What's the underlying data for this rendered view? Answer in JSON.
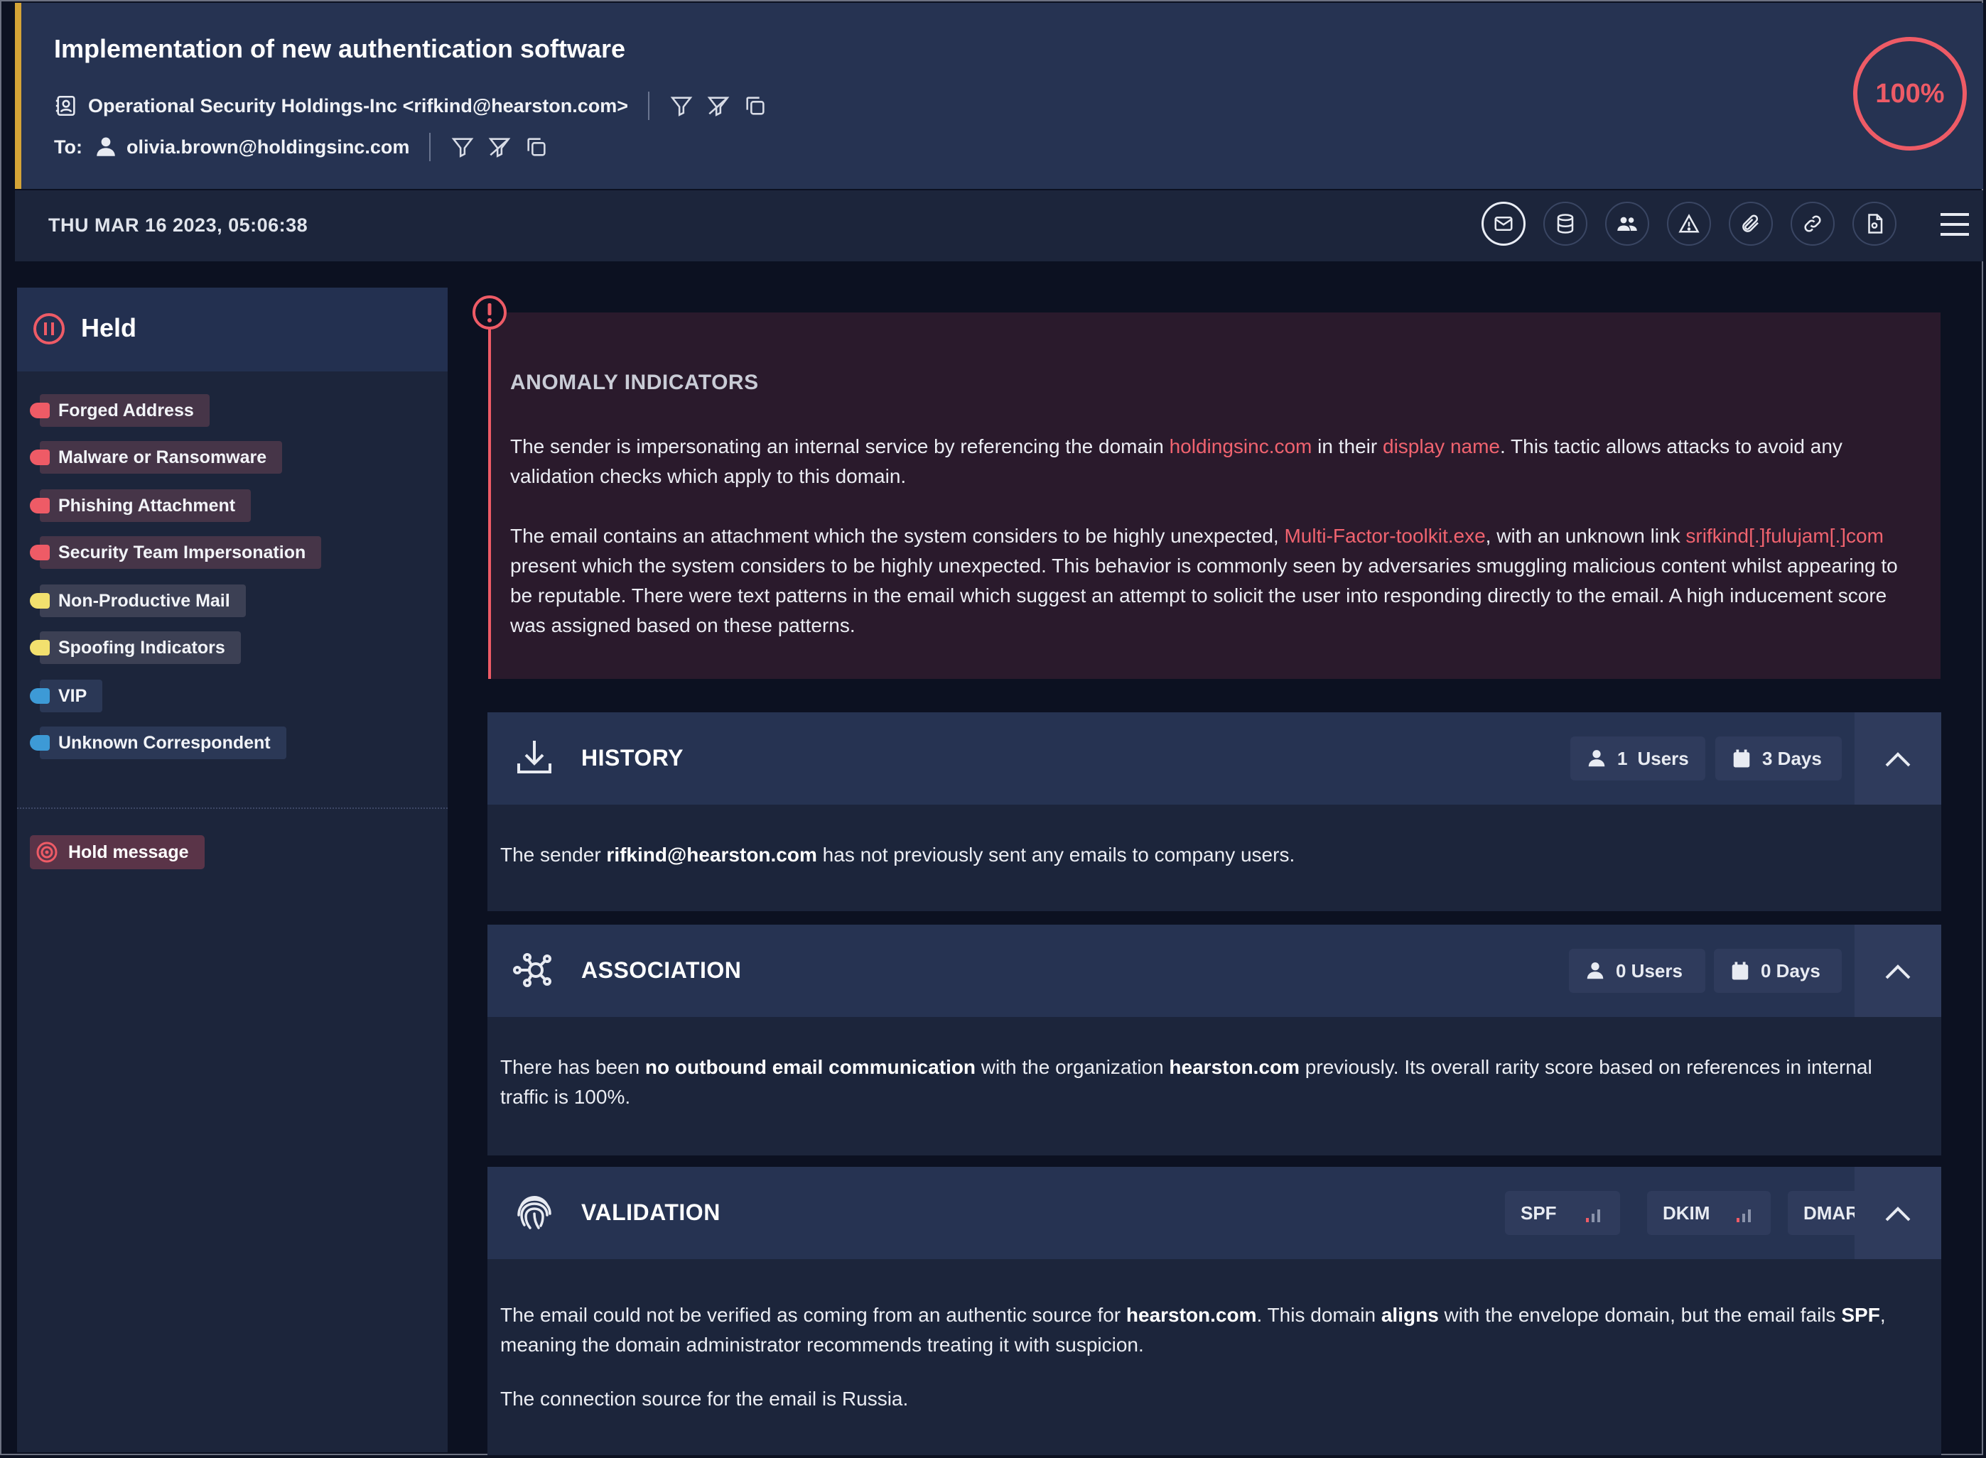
{
  "email": {
    "subject": "Implementation of new authentication software",
    "from": "Operational Security Holdings-Inc <rifkind@hearston.com>",
    "to_label": "To:",
    "to": "olivia.brown@holdingsinc.com",
    "score": "100%",
    "date": "THU MAR 16 2023, 05:06:38"
  },
  "toolbar": {
    "icons": [
      "envelope-icon",
      "database-icon",
      "users-icon",
      "warning-icon",
      "paperclip-icon",
      "link-icon",
      "file-icon"
    ],
    "active": "envelope-icon"
  },
  "sidebar": {
    "status": "Held",
    "tags": [
      {
        "label": "Forged Address",
        "color": "#ee5b66"
      },
      {
        "label": "Malware or Ransomware",
        "color": "#ee5b66"
      },
      {
        "label": "Phishing Attachment",
        "color": "#ee5b66"
      },
      {
        "label": "Security Team Impersonation",
        "color": "#ee5b66"
      },
      {
        "label": "Non-Productive Mail",
        "color": "#f2e06e"
      },
      {
        "label": "Spoofing Indicators",
        "color": "#f2e06e"
      },
      {
        "label": "VIP",
        "color": "#3d9ad6"
      },
      {
        "label": "Unknown Correspondent",
        "color": "#3d9ad6"
      }
    ],
    "hold_button": "Hold message"
  },
  "anomaly": {
    "title": "ANOMALY INDICATORS",
    "p1": {
      "t1": "The sender is impersonating an internal service by referencing the domain ",
      "h1": "holdingsinc.com",
      "t2": " in their ",
      "h2": "display name",
      "t3": ". This tactic allows attacks to avoid any validation checks which apply to this domain."
    },
    "p2": {
      "t1": "The email contains an attachment which the system considers to be highly unexpected, ",
      "h1": "Multi-Factor-toolkit.exe",
      "t2": ", with an unknown link ",
      "h2": "srifkind[.]fulujam[.]com",
      "t3": " present which the system considers to be highly unexpected. This behavior is commonly seen by adversaries smuggling malicious content whilst appearing to be reputable. There were text patterns in the email which suggest an attempt to solicit the user into responding directly to the email. A high inducement score was assigned based on these patterns."
    }
  },
  "history": {
    "title": "HISTORY",
    "users_count": "1",
    "users_label": "Users",
    "days": "3 Days",
    "body": {
      "t1": "The sender ",
      "b1": "rifkind@hearston.com",
      "t2": " has not previously sent any emails to company users."
    }
  },
  "association": {
    "title": "ASSOCIATION",
    "users": "0 Users",
    "days": "0 Days",
    "body": {
      "t1": "There has been ",
      "b1": "no outbound email communication",
      "t2": " with the organization ",
      "b2": "hearston.com",
      "t3": " previously. Its overall rarity score based on references in internal traffic is 100%."
    }
  },
  "validation": {
    "title": "VALIDATION",
    "chips": [
      "SPF",
      "DKIM",
      "DMARC"
    ],
    "body": {
      "t1": "The email could not be verified as coming from an authentic source for ",
      "b1": "hearston.com",
      "t2": ". This domain ",
      "b2": "aligns",
      "t3": " with the envelope domain, but the email fails ",
      "b3": "SPF",
      "t4": ", meaning the domain administrator recommends treating it with suspicion.",
      "p2": "The connection source for the email is Russia."
    }
  }
}
